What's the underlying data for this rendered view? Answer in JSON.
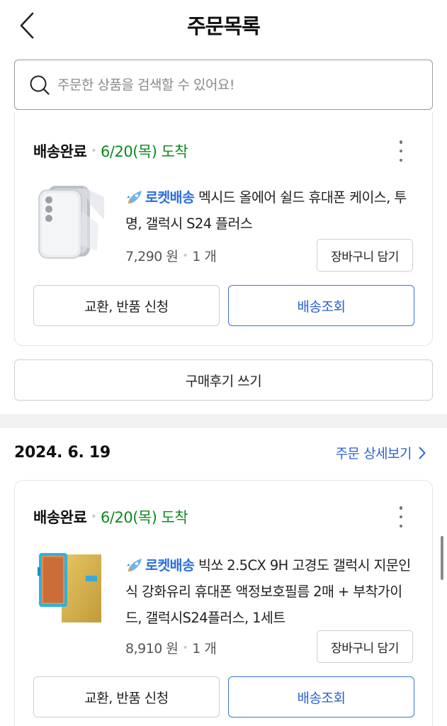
{
  "header": {
    "title": "주문목록"
  },
  "search": {
    "placeholder": "주문한 상품을 검색할 수 있어요!"
  },
  "orders": [
    {
      "status": "배송완료",
      "arrival": "6/20(목) 도착",
      "badge": "로켓배송",
      "product_name": "멕시드 올에어 쉴드 휴대폰 케이스, 투명, 갤럭시 S24 플러스",
      "price": "7,290 원",
      "quantity": "1 개",
      "cart_button": "장바구니 담기",
      "exchange_button": "교환, 반품 신청",
      "track_button": "배송조회"
    },
    {
      "status": "배송완료",
      "arrival": "6/20(목) 도착",
      "badge": "로켓배송",
      "product_name": "빅쏘 2.5CX 9H 고경도 갤럭시 지문인식 강화유리 휴대폰 액정보호필름 2매 + 부착가이드, 갤럭시S24플러스, 1세트",
      "price": "8,910 원",
      "quantity": "1 개",
      "cart_button": "장바구니 담기",
      "exchange_button": "교환, 반품 신청",
      "track_button": "배송조회"
    }
  ],
  "review_button": "구매후기 쓰기",
  "order_group": {
    "date": "2024. 6. 19",
    "detail_link": "주문 상세보기"
  },
  "colors": {
    "accent": "#2a62d4",
    "arrival_green": "#0e8a1e",
    "divider": "#f2f2f2"
  },
  "icons": [
    "back-arrow-icon",
    "search-icon",
    "more-vertical-icon",
    "rocket-icon",
    "chevron-right-icon"
  ]
}
